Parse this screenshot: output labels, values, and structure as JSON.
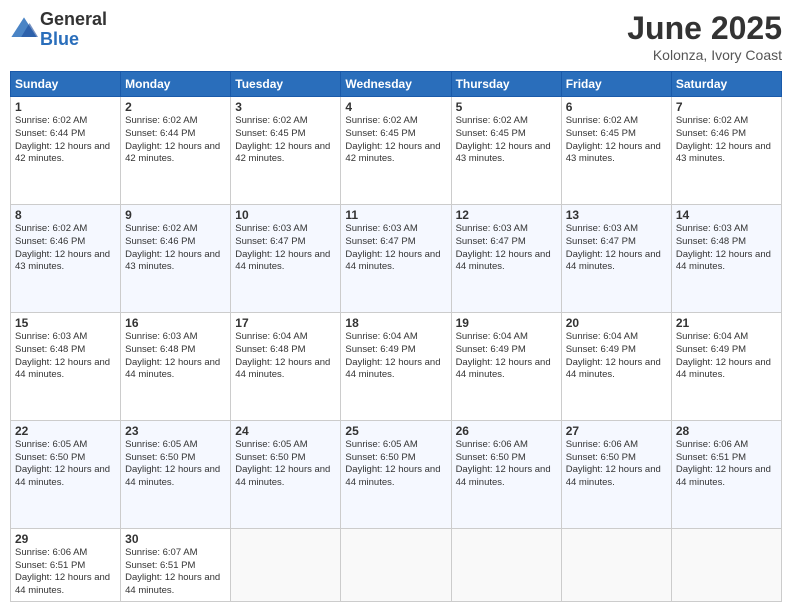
{
  "logo": {
    "general": "General",
    "blue": "Blue"
  },
  "title": "June 2025",
  "location": "Kolonza, Ivory Coast",
  "days_of_week": [
    "Sunday",
    "Monday",
    "Tuesday",
    "Wednesday",
    "Thursday",
    "Friday",
    "Saturday"
  ],
  "weeks": [
    [
      {
        "day": "1",
        "sunrise": "6:02 AM",
        "sunset": "6:44 PM",
        "daylight": "12 hours and 42 minutes."
      },
      {
        "day": "2",
        "sunrise": "6:02 AM",
        "sunset": "6:44 PM",
        "daylight": "12 hours and 42 minutes."
      },
      {
        "day": "3",
        "sunrise": "6:02 AM",
        "sunset": "6:45 PM",
        "daylight": "12 hours and 42 minutes."
      },
      {
        "day": "4",
        "sunrise": "6:02 AM",
        "sunset": "6:45 PM",
        "daylight": "12 hours and 42 minutes."
      },
      {
        "day": "5",
        "sunrise": "6:02 AM",
        "sunset": "6:45 PM",
        "daylight": "12 hours and 43 minutes."
      },
      {
        "day": "6",
        "sunrise": "6:02 AM",
        "sunset": "6:45 PM",
        "daylight": "12 hours and 43 minutes."
      },
      {
        "day": "7",
        "sunrise": "6:02 AM",
        "sunset": "6:46 PM",
        "daylight": "12 hours and 43 minutes."
      }
    ],
    [
      {
        "day": "8",
        "sunrise": "6:02 AM",
        "sunset": "6:46 PM",
        "daylight": "12 hours and 43 minutes."
      },
      {
        "day": "9",
        "sunrise": "6:02 AM",
        "sunset": "6:46 PM",
        "daylight": "12 hours and 43 minutes."
      },
      {
        "day": "10",
        "sunrise": "6:03 AM",
        "sunset": "6:47 PM",
        "daylight": "12 hours and 44 minutes."
      },
      {
        "day": "11",
        "sunrise": "6:03 AM",
        "sunset": "6:47 PM",
        "daylight": "12 hours and 44 minutes."
      },
      {
        "day": "12",
        "sunrise": "6:03 AM",
        "sunset": "6:47 PM",
        "daylight": "12 hours and 44 minutes."
      },
      {
        "day": "13",
        "sunrise": "6:03 AM",
        "sunset": "6:47 PM",
        "daylight": "12 hours and 44 minutes."
      },
      {
        "day": "14",
        "sunrise": "6:03 AM",
        "sunset": "6:48 PM",
        "daylight": "12 hours and 44 minutes."
      }
    ],
    [
      {
        "day": "15",
        "sunrise": "6:03 AM",
        "sunset": "6:48 PM",
        "daylight": "12 hours and 44 minutes."
      },
      {
        "day": "16",
        "sunrise": "6:03 AM",
        "sunset": "6:48 PM",
        "daylight": "12 hours and 44 minutes."
      },
      {
        "day": "17",
        "sunrise": "6:04 AM",
        "sunset": "6:48 PM",
        "daylight": "12 hours and 44 minutes."
      },
      {
        "day": "18",
        "sunrise": "6:04 AM",
        "sunset": "6:49 PM",
        "daylight": "12 hours and 44 minutes."
      },
      {
        "day": "19",
        "sunrise": "6:04 AM",
        "sunset": "6:49 PM",
        "daylight": "12 hours and 44 minutes."
      },
      {
        "day": "20",
        "sunrise": "6:04 AM",
        "sunset": "6:49 PM",
        "daylight": "12 hours and 44 minutes."
      },
      {
        "day": "21",
        "sunrise": "6:04 AM",
        "sunset": "6:49 PM",
        "daylight": "12 hours and 44 minutes."
      }
    ],
    [
      {
        "day": "22",
        "sunrise": "6:05 AM",
        "sunset": "6:50 PM",
        "daylight": "12 hours and 44 minutes."
      },
      {
        "day": "23",
        "sunrise": "6:05 AM",
        "sunset": "6:50 PM",
        "daylight": "12 hours and 44 minutes."
      },
      {
        "day": "24",
        "sunrise": "6:05 AM",
        "sunset": "6:50 PM",
        "daylight": "12 hours and 44 minutes."
      },
      {
        "day": "25",
        "sunrise": "6:05 AM",
        "sunset": "6:50 PM",
        "daylight": "12 hours and 44 minutes."
      },
      {
        "day": "26",
        "sunrise": "6:06 AM",
        "sunset": "6:50 PM",
        "daylight": "12 hours and 44 minutes."
      },
      {
        "day": "27",
        "sunrise": "6:06 AM",
        "sunset": "6:50 PM",
        "daylight": "12 hours and 44 minutes."
      },
      {
        "day": "28",
        "sunrise": "6:06 AM",
        "sunset": "6:51 PM",
        "daylight": "12 hours and 44 minutes."
      }
    ],
    [
      {
        "day": "29",
        "sunrise": "6:06 AM",
        "sunset": "6:51 PM",
        "daylight": "12 hours and 44 minutes."
      },
      {
        "day": "30",
        "sunrise": "6:07 AM",
        "sunset": "6:51 PM",
        "daylight": "12 hours and 44 minutes."
      },
      null,
      null,
      null,
      null,
      null
    ]
  ]
}
